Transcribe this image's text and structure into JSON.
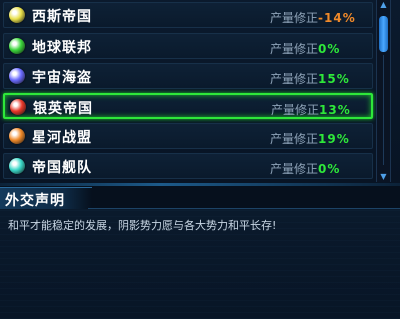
{
  "factions": [
    {
      "name": "西斯帝国",
      "modifier_label": "产量修正",
      "modifier_value": "-14%",
      "value_color": "#f08a2a",
      "orb_color": "#e8e04a",
      "selected": false
    },
    {
      "name": "地球联邦",
      "modifier_label": "产量修正",
      "modifier_value": "0%",
      "value_color": "#2ee83a",
      "orb_color": "#3bd63b",
      "selected": false
    },
    {
      "name": "宇宙海盗",
      "modifier_label": "产量修正",
      "modifier_value": "15%",
      "value_color": "#2ee83a",
      "orb_color": "#6b6bff",
      "selected": false
    },
    {
      "name": "银英帝国",
      "modifier_label": "产量修正",
      "modifier_value": "13%",
      "value_color": "#2ee83a",
      "orb_color": "#e8382a",
      "selected": true
    },
    {
      "name": "星河战盟",
      "modifier_label": "产量修正",
      "modifier_value": "19%",
      "value_color": "#2ee83a",
      "orb_color": "#f08a2a",
      "selected": false
    },
    {
      "name": "帝国舰队",
      "modifier_label": "产量修正",
      "modifier_value": "0%",
      "value_color": "#2ee83a",
      "orb_color": "#3ad8c8",
      "selected": false
    }
  ],
  "diplomacy": {
    "title": "外交声明",
    "text": "和平才能稳定的发展，阴影势力愿与各大势力和平长存!"
  },
  "scrollbar": {
    "up_icon": "arrow-up-icon",
    "down_icon": "arrow-down-icon"
  }
}
